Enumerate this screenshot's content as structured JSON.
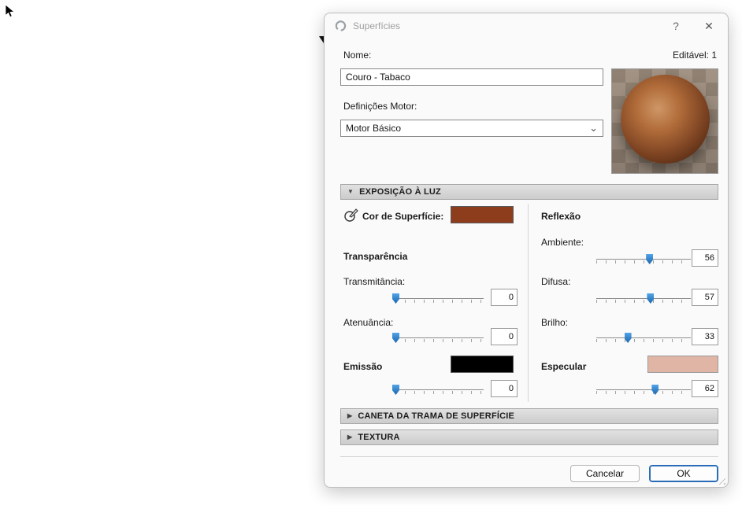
{
  "icons": {
    "expanded": "▼",
    "collapsed": "▶",
    "dropdown": "⌄",
    "help": "?",
    "close": "✕"
  },
  "dialog": {
    "title": "Superfícies",
    "editable": "Editável: 1",
    "name": {
      "label": "Nome:",
      "value": "Couro - Tabaco"
    },
    "engine": {
      "label": "Definições Motor:",
      "value": "Motor Básico"
    },
    "sections": [
      {
        "label": "EXPOSIÇÃO À LUZ",
        "expanded": true
      },
      {
        "label": "CANETA DA TRAMA DE SUPERFÍCIE",
        "expanded": false
      },
      {
        "label": "TEXTURA",
        "expanded": false
      }
    ],
    "exposure": {
      "surface_color": {
        "label": "Cor de Superfície:",
        "color": "#8e3d1c"
      },
      "reflection_label": "Reflexão",
      "transparency_label": "Transparência",
      "ambiente": {
        "label": "Ambiente:",
        "value": 56
      },
      "transmitancia": {
        "label": "Transmitância:",
        "value": 0
      },
      "difusa": {
        "label": "Difusa:",
        "value": 57
      },
      "atenuancia": {
        "label": "Atenuância:",
        "value": 0
      },
      "brilho": {
        "label": "Brilho:",
        "value": 33
      },
      "emissao": {
        "label": "Emissão",
        "value": 0,
        "color": "#000000"
      },
      "especular": {
        "label": "Especular",
        "value": 62,
        "color": "#e0b5a5"
      }
    },
    "buttons": {
      "cancel": "Cancelar",
      "ok": "OK"
    }
  }
}
